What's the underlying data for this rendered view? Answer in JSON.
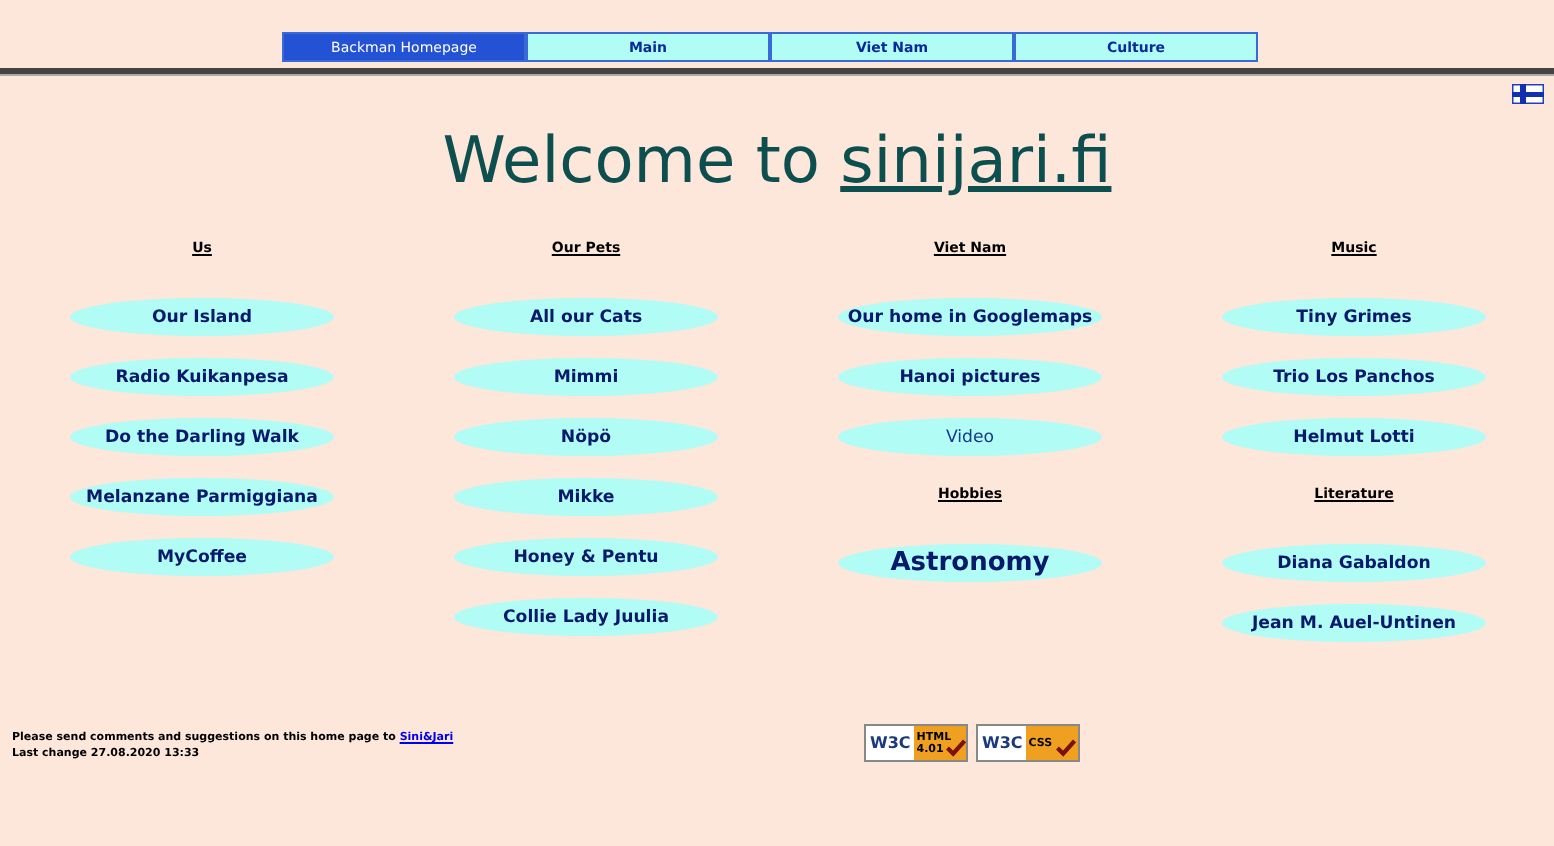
{
  "nav": [
    {
      "label": "Backman Homepage",
      "selected": true
    },
    {
      "label": "Main",
      "selected": false
    },
    {
      "label": "Viet Nam",
      "selected": false
    },
    {
      "label": "Culture",
      "selected": false
    }
  ],
  "title": {
    "prefix": "Welcome to ",
    "link": "sinijari.fi"
  },
  "columns": [
    {
      "entries": [
        {
          "kind": "heading",
          "label": "Us"
        },
        {
          "kind": "link",
          "label": "Our Island",
          "visited": false
        },
        {
          "kind": "link",
          "label": "Radio Kuikanpesa",
          "visited": false
        },
        {
          "kind": "link",
          "label": "Do the Darling Walk",
          "visited": false
        },
        {
          "kind": "link",
          "label": "Melanzane Parmiggiana",
          "visited": false
        },
        {
          "kind": "link",
          "label": "MyCoffee",
          "visited": false
        }
      ]
    },
    {
      "entries": [
        {
          "kind": "heading",
          "label": "Our Pets"
        },
        {
          "kind": "link",
          "label": "All our Cats",
          "visited": false
        },
        {
          "kind": "link",
          "label": "Mimmi",
          "visited": false
        },
        {
          "kind": "link",
          "label": "Nöpö",
          "visited": false
        },
        {
          "kind": "link",
          "label": "Mikke",
          "visited": false
        },
        {
          "kind": "link",
          "label": "Honey & Pentu",
          "visited": false
        },
        {
          "kind": "link",
          "label": "Collie Lady Juulia",
          "visited": false
        }
      ]
    },
    {
      "entries": [
        {
          "kind": "heading",
          "label": "Viet Nam"
        },
        {
          "kind": "link",
          "label": "Our home in Googlemaps",
          "visited": false
        },
        {
          "kind": "link",
          "label": "Hanoi pictures",
          "visited": false
        },
        {
          "kind": "link",
          "label": "Video",
          "visited": true
        },
        {
          "kind": "heading",
          "label": "Hobbies"
        },
        {
          "kind": "large-link",
          "label": "Astronomy",
          "visited": false
        }
      ]
    },
    {
      "entries": [
        {
          "kind": "heading",
          "label": "Music"
        },
        {
          "kind": "link",
          "label": "Tiny Grimes",
          "visited": false
        },
        {
          "kind": "link",
          "label": "Trio Los Panchos",
          "visited": false
        },
        {
          "kind": "link",
          "label": "Helmut Lotti",
          "visited": false
        },
        {
          "kind": "heading",
          "label": "Literature"
        },
        {
          "kind": "link",
          "label": "Diana Gabaldon",
          "visited": false
        },
        {
          "kind": "link",
          "label": "Jean M. Auel-Untinen",
          "visited": false
        }
      ]
    }
  ],
  "footer": {
    "comment": "Please send comments and suggestions on this home page to ",
    "contact_link": "Sini&Jari",
    "last_change": "Last change 27.08.2020 13:33"
  },
  "badges": [
    {
      "logo": "W3C",
      "label": "HTML 4.01"
    },
    {
      "logo": "W3C",
      "label": "CSS"
    }
  ]
}
